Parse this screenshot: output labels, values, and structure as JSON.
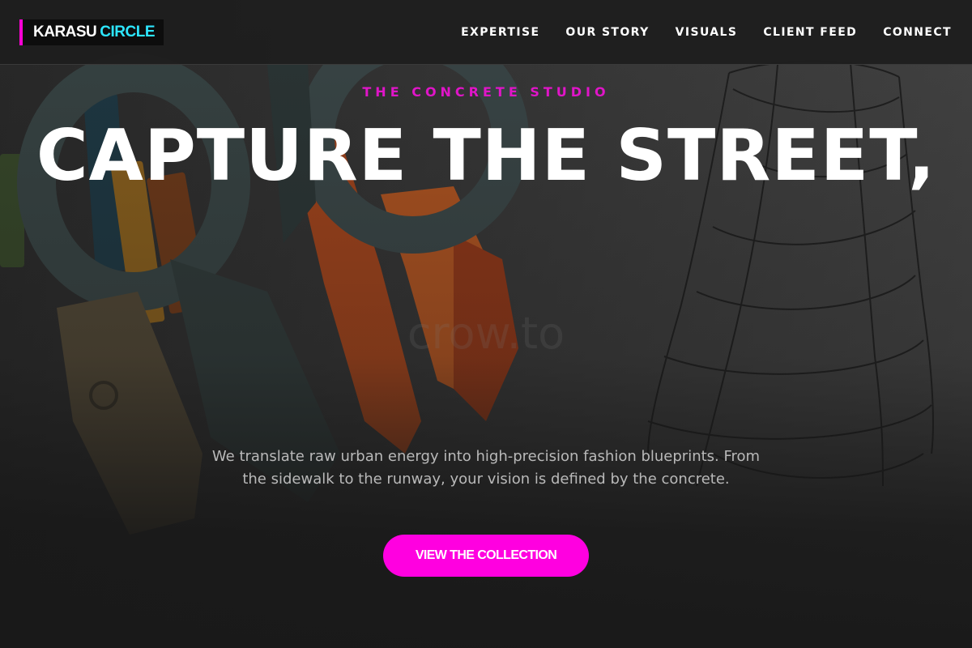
{
  "header": {
    "logo": {
      "word1": "KARASU",
      "word2": "CIRCLE"
    },
    "nav": [
      {
        "label": "EXPERTISE"
      },
      {
        "label": "OUR STORY"
      },
      {
        "label": "VISUALS"
      },
      {
        "label": "CLIENT FEED"
      },
      {
        "label": "CONNECT"
      }
    ]
  },
  "hero": {
    "eyebrow": "THE CONCRETE STUDIO",
    "headline": "CAPTURE THE STREET,",
    "watermark": "crow.to",
    "description": "We translate raw urban energy into high-precision fashion blueprints. From the sidewalk to the runway, your vision is defined by the concrete.",
    "cta_label": "VIEW THE COLLECTION"
  },
  "colors": {
    "accent_magenta": "#ff00e0",
    "accent_cyan": "#2de6ff",
    "header_bg": "#1e1e1e",
    "text_muted": "#b9b9b9"
  }
}
